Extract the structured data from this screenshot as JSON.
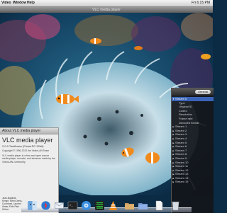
{
  "menubar": {
    "items": [
      "Video",
      "Window",
      "Help"
    ],
    "right_text": "Fri 6:15 PM"
  },
  "video_window": {
    "title": "VLC media player"
  },
  "info_panel": {
    "tab_label": "General",
    "rows": [
      {
        "label": "Stream 0",
        "expanded": true,
        "selected": true
      },
      {
        "label": "Type",
        "child": true
      },
      {
        "label": "Original ID",
        "child": true
      },
      {
        "label": "Codec",
        "child": true
      },
      {
        "label": "Resolution",
        "child": true
      },
      {
        "label": "Frame rate",
        "child": true
      },
      {
        "label": "Decoded format",
        "child": true
      },
      {
        "label": "Stream 1"
      },
      {
        "label": "Stream 2"
      },
      {
        "label": "Stream 3"
      },
      {
        "label": "Stream 4"
      },
      {
        "label": "Stream 5"
      },
      {
        "label": "Stream 6"
      },
      {
        "label": "Stream 7"
      },
      {
        "label": "Stream 8"
      },
      {
        "label": "Stream 9"
      },
      {
        "label": "Stream 10"
      },
      {
        "label": "Stream 11"
      },
      {
        "label": "Stream 12"
      },
      {
        "label": "Stream 13"
      },
      {
        "label": "Stream 14"
      },
      {
        "label": "Stream 15"
      }
    ]
  },
  "about": {
    "window_title": "About VLC media player",
    "title": "VLC media player",
    "version": "2.0.0 Twoflower (PowerPC 32bit)",
    "blurb": "Copyright © 1996-2012 the VideoLAN Team",
    "blurb2": "VLC media player is a free and open source media player, encoder, and streamer made by the VideoLAN community.",
    "credits": "Jean-Baptiste Kempf, Rémi Denis-Courmont, Laurent Aimar, Felix Paul Kühne"
  },
  "dock": {
    "icons": [
      "finder-icon",
      "safari-icon",
      "mail-icon",
      "terminal-icon",
      "itunes-icon",
      "activity-monitor-icon",
      "vlc-icon",
      "documents-folder-icon",
      "downloads-folder-icon",
      "file-icon",
      "trash-icon"
    ]
  },
  "colors": {
    "selection": "#3b64b8",
    "panel_bg": "#14161a",
    "vlc_orange": "#f28c1c"
  }
}
